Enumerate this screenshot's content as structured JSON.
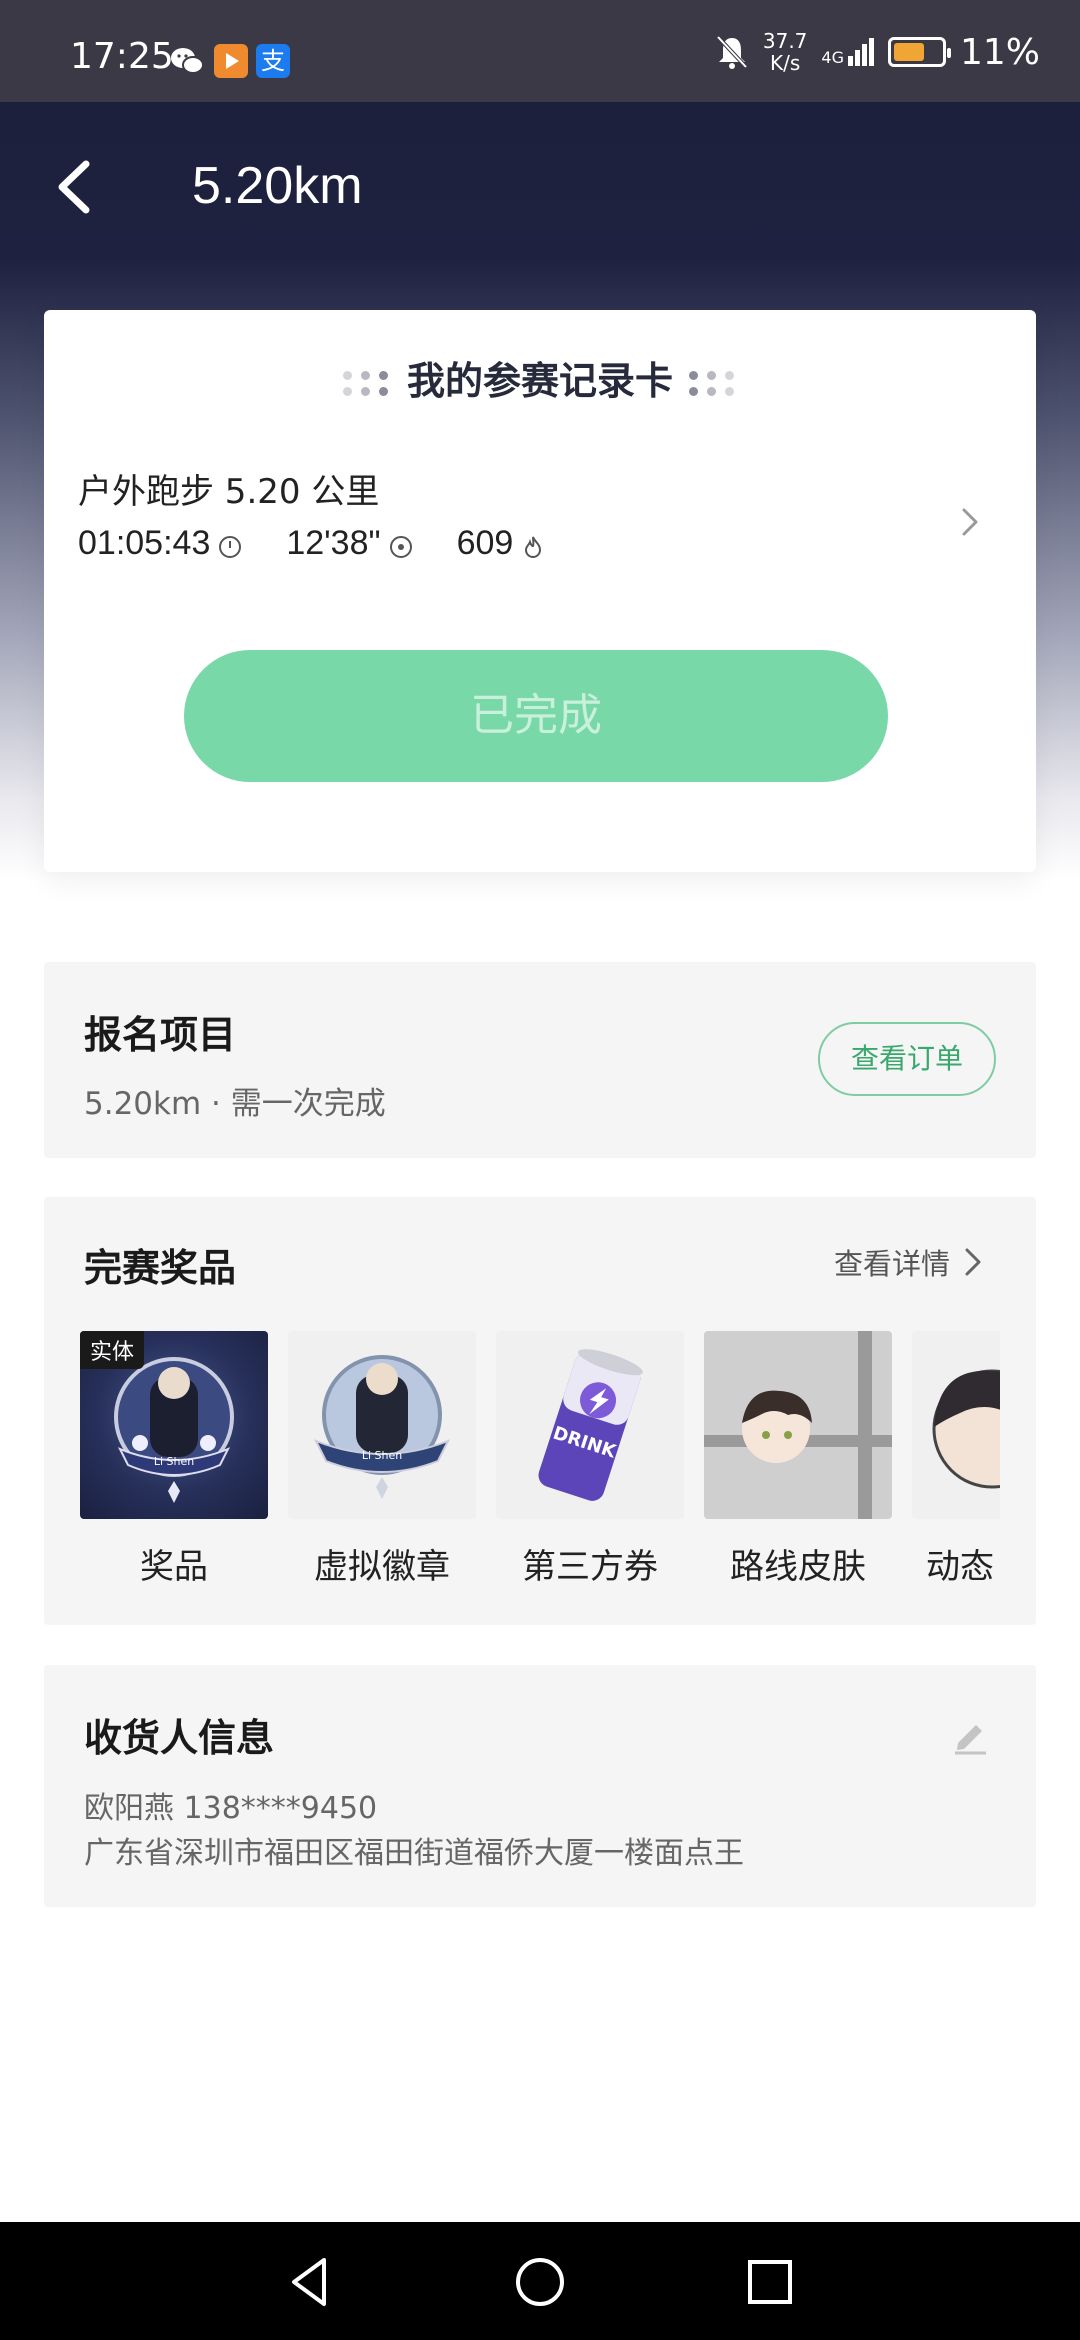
{
  "status_bar": {
    "time": "17:25",
    "network_speed_value": "37.7",
    "network_speed_unit": "K/s",
    "signal_label": "4G",
    "battery_percent": "11%",
    "icons": [
      "wechat-icon",
      "video-app-icon",
      "alipay-icon",
      "mute-icon",
      "signal-icon",
      "battery-icon"
    ],
    "alipay_glyph": "支"
  },
  "header": {
    "title": "5.20km"
  },
  "record_card": {
    "heading": "我的参赛记录卡",
    "run_type": "户外跑步 5.20 公里",
    "duration": "01:05:43",
    "pace": "12'38\"",
    "calories": "609",
    "status_button": "已完成"
  },
  "signup": {
    "title": "报名项目",
    "subtitle": "5.20km · 需一次完成",
    "order_button": "查看订单"
  },
  "prizes": {
    "title": "完赛奖品",
    "details_link": "查看详情",
    "items": [
      {
        "label": "奖品",
        "tag": "实体",
        "badge_text": "Li Shen"
      },
      {
        "label": "虚拟徽章",
        "badge_text": "Li Shen"
      },
      {
        "label": "第三方券",
        "can_text": "DRINK"
      },
      {
        "label": "路线皮肤"
      },
      {
        "label": "动态"
      }
    ]
  },
  "receiver": {
    "title": "收货人信息",
    "name_phone": "欧阳燕 138****9450",
    "address": "广东省深圳市福田区福田街道福侨大厦一楼面点王"
  },
  "colors": {
    "header_dark": "#1c1f3a",
    "done_green": "#79d8a8",
    "order_green": "#38a86d",
    "section_bg": "#f5f5f5"
  }
}
